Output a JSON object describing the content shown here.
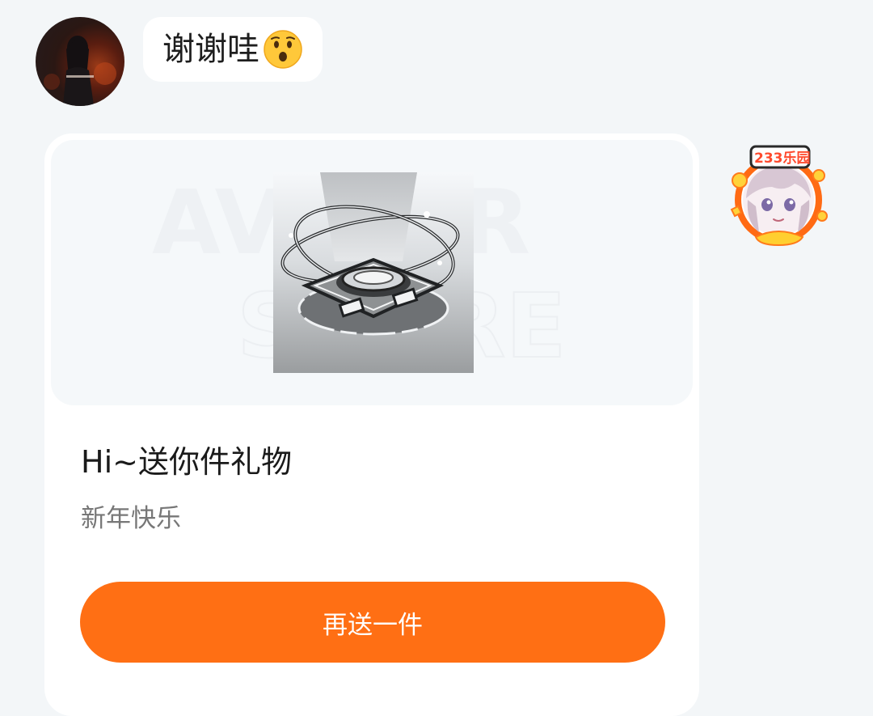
{
  "messages": {
    "incoming": {
      "text": "谢谢哇",
      "emoji": "hushed-face-emoji"
    },
    "gift": {
      "watermark_line1": "AVATAR",
      "watermark_line2": "STORE",
      "title": "Hi~送你件礼物",
      "subtitle": "新年快乐",
      "button_label": "再送一件"
    },
    "sender_badge": {
      "text": "233乐园"
    }
  },
  "colors": {
    "page_background": "#f3f6f8",
    "bubble_background": "#ffffff",
    "accent": "#ff6f14"
  }
}
